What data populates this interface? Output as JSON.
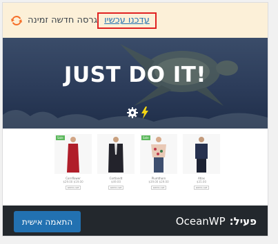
{
  "notice": {
    "text": "גרסה חדשה זמינה",
    "update_link": "עדכנו עכשיו"
  },
  "hero": {
    "headline": "JUST DO IT!"
  },
  "products": [
    {
      "name": "Cornflower",
      "price": "$29.00 $19.00",
      "sale": "Sale",
      "cart": "Add to cart"
    },
    {
      "name": "Cortlandt",
      "price": "$49.00",
      "sale": "",
      "cart": "Add to cart"
    },
    {
      "name": "Plumthorn",
      "price": "$39.00 $29.00",
      "sale": "Sale",
      "cart": "Add to cart"
    },
    {
      "name": "Atlas",
      "price": "$35.00",
      "sale": "",
      "cart": "Add to cart"
    }
  ],
  "footer": {
    "active_label": "פעיל:",
    "theme_name": "OceanWP",
    "customize_label": "התאמה אישית"
  },
  "colors": {
    "notice_bg": "#fcf0d8",
    "refresh_icon": "#f56e28",
    "link": "#2271b1",
    "highlight_border": "#e02020",
    "footer_bg": "#23282d",
    "button_bg": "#2271b1"
  }
}
